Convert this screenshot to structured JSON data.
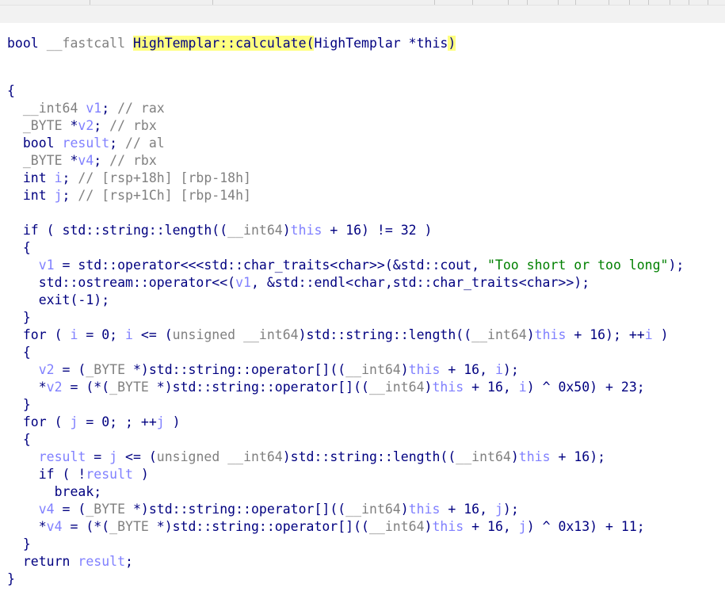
{
  "code_view": {
    "signature": {
      "ret_type": "bool",
      "callconv": "__fastcall",
      "func_name": "HighTemplar::calculate",
      "paren_open": "(",
      "param_type": "HighTemplar *",
      "param_name": "this",
      "paren_close": ")"
    },
    "lines": [
      "{",
      "  __int64 v1; // rax",
      "  _BYTE *v2; // rbx",
      "  bool result; // al",
      "  _BYTE *v4; // rbx",
      "  int i; // [rsp+18h] [rbp-18h]",
      "  int j; // [rsp+1Ch] [rbp-14h]",
      "",
      "  if ( std::string::length((__int64)this + 16) != 32 )",
      "  {",
      "    v1 = std::operator<<<std::char_traits<char>>(&std::cout, \"Too short or too long\");",
      "    std::ostream::operator<<(v1, &std::endl<char,std::char_traits<char>>);",
      "    exit(-1);",
      "  }",
      "  for ( i = 0; i <= (unsigned __int64)std::string::length((__int64)this + 16); ++i )",
      "  {",
      "    v2 = (_BYTE *)std::string::operator[]((__int64)this + 16, i);",
      "    *v2 = (*(_BYTE *)std::string::operator[]((__int64)this + 16, i) ^ 0x50) + 23;",
      "  }",
      "  for ( j = 0; ; ++j )",
      "  {",
      "    result = j <= (unsigned __int64)std::string::length((__int64)this + 16);",
      "    if ( !result )",
      "      break;",
      "    v4 = (_BYTE *)std::string::operator[]((__int64)this + 16, j);",
      "    *v4 = (*(_BYTE *)std::string::operator[]((__int64)this + 16, j) ^ 0x13) + 11;",
      "  }",
      "  return result;",
      "}"
    ]
  }
}
